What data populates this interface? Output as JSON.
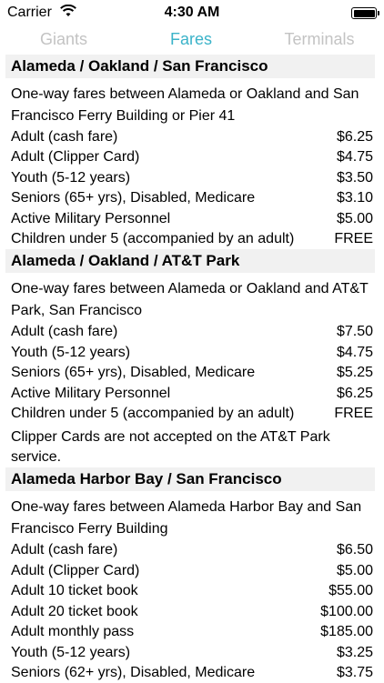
{
  "status_bar": {
    "carrier": "Carrier",
    "time": "4:30 AM"
  },
  "tabs": [
    {
      "label": "Giants"
    },
    {
      "label": "Fares"
    },
    {
      "label": "Terminals"
    }
  ],
  "sections": [
    {
      "title": "Alameda / Oakland / San Francisco",
      "description": "One-way fares between Alameda or Oakland and San Francisco Ferry Building or Pier 41",
      "rows": [
        {
          "label": "Adult (cash fare)",
          "value": "$6.25"
        },
        {
          "label": "Adult (Clipper Card)",
          "value": "$4.75"
        },
        {
          "label": "Youth (5-12 years)",
          "value": "$3.50"
        },
        {
          "label": "Seniors (65+ yrs), Disabled, Medicare",
          "value": "$3.10"
        },
        {
          "label": "Active Military Personnel",
          "value": "$5.00"
        },
        {
          "label": "Children under 5 (accompanied by an adult)",
          "value": "FREE"
        }
      ]
    },
    {
      "title": "Alameda / Oakland / AT&T Park",
      "description": "One-way fares between Alameda or Oakland and AT&T Park, San Francisco",
      "rows": [
        {
          "label": "Adult (cash fare)",
          "value": "$7.50"
        },
        {
          "label": "Youth (5-12 years)",
          "value": "$4.75"
        },
        {
          "label": "Seniors (65+ yrs), Disabled, Medicare",
          "value": "$5.25"
        },
        {
          "label": "Active Military Personnel",
          "value": "$6.25"
        },
        {
          "label": "Children under 5 (accompanied by an adult)",
          "value": "FREE"
        }
      ],
      "note": "Clipper Cards are not accepted on the AT&T Park service."
    },
    {
      "title": "Alameda Harbor Bay / San Francisco",
      "description": "One-way fares between Alameda Harbor Bay and San Francisco Ferry Building",
      "rows": [
        {
          "label": "Adult (cash fare)",
          "value": "$6.50"
        },
        {
          "label": "Adult (Clipper Card)",
          "value": "$5.00"
        },
        {
          "label": "Adult 10 ticket book",
          "value": "$55.00"
        },
        {
          "label": "Adult 20 ticket book",
          "value": "$100.00"
        },
        {
          "label": "Adult monthly pass",
          "value": "$185.00"
        },
        {
          "label": "Youth (5-12 years)",
          "value": "$3.25"
        },
        {
          "label": "Seniors (62+ yrs), Disabled, Medicare",
          "value": "$3.75"
        }
      ]
    }
  ],
  "colors": {
    "active_tab": "#3bb3c9",
    "inactive_tab": "#c3c3c3",
    "section_header_bg": "#f1f1f1"
  },
  "icons": {
    "wifi": "wifi-icon",
    "battery": "battery-icon"
  }
}
